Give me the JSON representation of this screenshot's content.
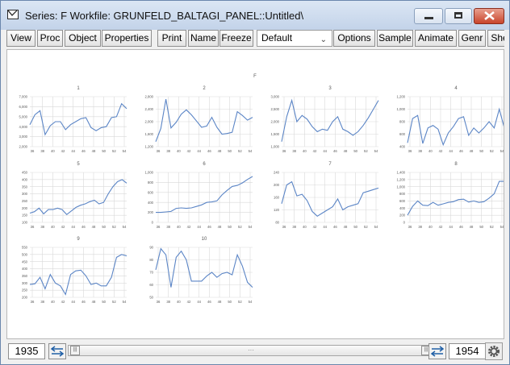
{
  "window": {
    "title": "Series: F   Workfile: GRUNFELD_BALTAGI_PANEL::Untitled\\"
  },
  "toolbar": {
    "buttons": [
      "View",
      "Proc",
      "Object",
      "Properties",
      "Print",
      "Name",
      "Freeze",
      "Options",
      "Sample",
      "Animate",
      "Genr",
      "She"
    ],
    "dropdown_value": "Default"
  },
  "graph": {
    "super_title": "F",
    "x_tick_labels": [
      "36",
      "38",
      "40",
      "42",
      "44",
      "46",
      "48",
      "50",
      "52",
      "54"
    ],
    "panels": [
      {
        "title": "1",
        "ylim": [
          2000,
          7000
        ],
        "yticks": [
          2000,
          3000,
          4000,
          5000,
          6000,
          7000
        ],
        "ylabels": [
          "2,000",
          "3,000",
          "4,000",
          "5,000",
          "6,000",
          "7,000"
        ],
        "values": [
          4200,
          5200,
          5600,
          3200,
          4100,
          4500,
          4500,
          3700,
          4200,
          4500,
          4800,
          4900,
          3900,
          3600,
          3900,
          4000,
          4900,
          5000,
          6300,
          5800
        ]
      },
      {
        "title": "2",
        "ylim": [
          1200,
          2800
        ],
        "yticks": [
          1200,
          1600,
          2000,
          2400,
          2800
        ],
        "ylabels": [
          "1,200",
          "1,600",
          "2,000",
          "2,400",
          "2,800"
        ],
        "values": [
          1360,
          1780,
          2720,
          1800,
          1980,
          2240,
          2380,
          2220,
          2020,
          1820,
          1860,
          2140,
          1820,
          1600,
          1620,
          1660,
          2320,
          2200,
          2050,
          2140
        ]
      },
      {
        "title": "3",
        "ylim": [
          1000,
          3000
        ],
        "yticks": [
          1000,
          1500,
          2000,
          2500,
          3000
        ],
        "ylabels": [
          "1,000",
          "1,500",
          "2,000",
          "2,500",
          "3,000"
        ],
        "values": [
          1200,
          2200,
          2850,
          2000,
          2250,
          2100,
          1800,
          1600,
          1700,
          1650,
          2000,
          2200,
          1700,
          1600,
          1450,
          1600,
          1850,
          2150,
          2500,
          2850
        ]
      },
      {
        "title": "4",
        "ylim": [
          400,
          1200
        ],
        "yticks": [
          400,
          600,
          800,
          1000,
          1200
        ],
        "ylabels": [
          "400",
          "600",
          "800",
          "1,000",
          "1,200"
        ],
        "values": [
          460,
          850,
          900,
          450,
          700,
          740,
          680,
          430,
          620,
          720,
          850,
          880,
          580,
          700,
          620,
          700,
          800,
          700,
          1000,
          700
        ]
      },
      {
        "title": "5",
        "ylim": [
          100,
          450
        ],
        "yticks": [
          100,
          150,
          200,
          250,
          300,
          350,
          400,
          450
        ],
        "ylabels": [
          "100",
          "150",
          "200",
          "250",
          "300",
          "350",
          "400",
          "450"
        ],
        "values": [
          165,
          175,
          200,
          160,
          190,
          190,
          200,
          190,
          155,
          180,
          205,
          220,
          230,
          245,
          255,
          230,
          240,
          300,
          350,
          385,
          400,
          375
        ]
      },
      {
        "title": "6",
        "ylim": [
          0,
          1000
        ],
        "yticks": [
          0,
          200,
          400,
          600,
          800,
          1000
        ],
        "ylabels": [
          "0",
          "200",
          "400",
          "600",
          "800",
          "1,000"
        ],
        "values": [
          200,
          200,
          210,
          220,
          280,
          290,
          280,
          290,
          320,
          350,
          400,
          410,
          430,
          550,
          640,
          720,
          740,
          790,
          860,
          920
        ]
      },
      {
        "title": "7",
        "ylim": [
          80,
          240
        ],
        "yticks": [
          80,
          120,
          160,
          200,
          240
        ],
        "ylabels": [
          "80",
          "120",
          "160",
          "200",
          "240"
        ],
        "values": [
          140,
          200,
          210,
          165,
          170,
          150,
          115,
          100,
          110,
          120,
          130,
          155,
          120,
          130,
          135,
          140,
          175,
          180,
          185,
          190
        ]
      },
      {
        "title": "8",
        "ylim": [
          0,
          1400
        ],
        "yticks": [
          0,
          200,
          400,
          600,
          800,
          1000,
          1200,
          1400
        ],
        "ylabels": [
          "0",
          "200",
          "400",
          "600",
          "800",
          "1,000",
          "1,200",
          "1,400"
        ],
        "values": [
          200,
          450,
          600,
          480,
          470,
          560,
          480,
          520,
          560,
          580,
          640,
          650,
          570,
          600,
          560,
          580,
          680,
          800,
          1150,
          1150
        ]
      },
      {
        "title": "9",
        "ylim": [
          200,
          550
        ],
        "yticks": [
          200,
          250,
          300,
          350,
          400,
          450,
          500,
          550
        ],
        "ylabels": [
          "200",
          "250",
          "300",
          "350",
          "400",
          "450",
          "500",
          "550"
        ],
        "values": [
          290,
          295,
          340,
          260,
          360,
          300,
          280,
          220,
          360,
          385,
          390,
          350,
          290,
          300,
          280,
          280,
          340,
          480,
          500,
          490
        ]
      },
      {
        "title": "10",
        "ylim": [
          50,
          90
        ],
        "yticks": [
          50,
          60,
          70,
          80,
          90
        ],
        "ylabels": [
          "50",
          "60",
          "70",
          "80",
          "90"
        ],
        "values": [
          72,
          89,
          84,
          58,
          82,
          87,
          80,
          63,
          63,
          63,
          67,
          70,
          66,
          69,
          70,
          68,
          84,
          75,
          62,
          58
        ]
      }
    ]
  },
  "statusbar": {
    "start_year": "1935",
    "end_year": "1954"
  },
  "colors": {
    "line": "#5b85c6",
    "grid": "#d9d9d9",
    "tick_text": "#595959"
  }
}
